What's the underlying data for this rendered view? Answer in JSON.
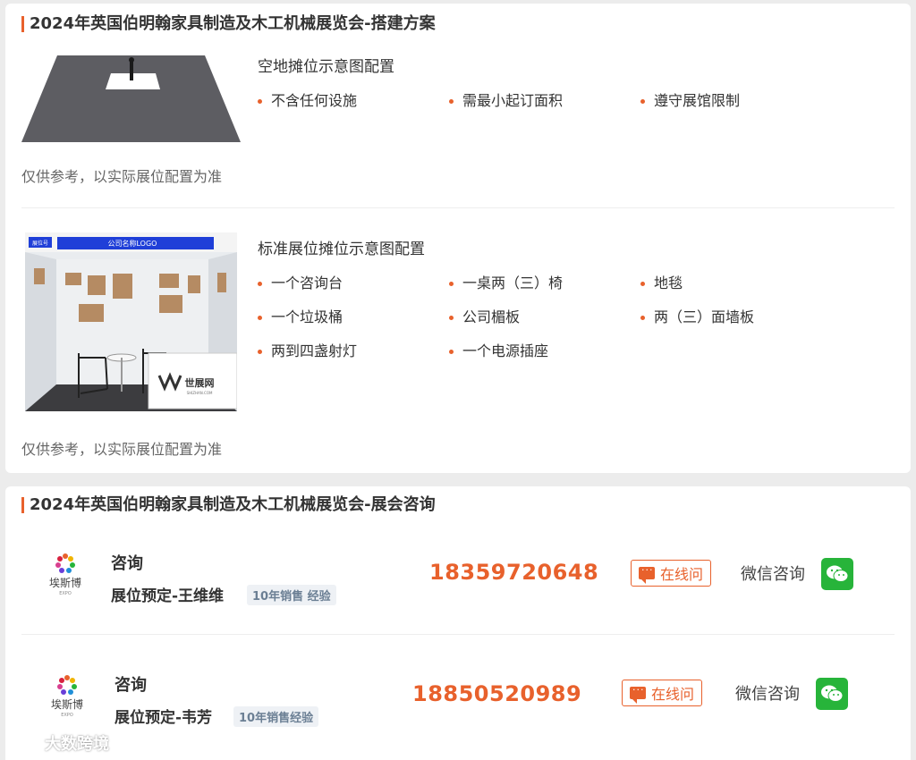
{
  "booth": {
    "title": "2024年英国伯明翰家具制造及木工机械展览会-搭建方案",
    "plans": [
      {
        "title": "空地摊位示意图配置",
        "features": [
          "不含任何设施",
          "需最小起订面积",
          "遵守展馆限制"
        ],
        "note": "仅供参考，以实际展位配置为准"
      },
      {
        "title": "标准展位摊位示意图配置",
        "features": [
          "一个咨询台",
          "一桌两（三）椅",
          "地毯",
          "一个垃圾桶",
          "公司楣板",
          "两（三）面墙板",
          "两到四盏射灯",
          "一个电源插座"
        ],
        "note": "仅供参考，以实际展位配置为准",
        "image_labels": {
          "booth_no": "展位号",
          "fascia": "公司名称LOGO",
          "desk_brand": "世展网",
          "desk_sub": "SHIZHAN.COM"
        }
      }
    ]
  },
  "consult": {
    "title": "2024年英国伯明翰家具制造及木工机械展览会-展会咨询",
    "contacts": [
      {
        "logo_text": "埃斯博",
        "logo_sub": "EXPO",
        "label": "咨询",
        "name": "展位预定-王维维",
        "tag": "10年销售 经验",
        "phone": "18359720648",
        "online": "在线问",
        "wechat": "微信咨询"
      },
      {
        "logo_text": "埃斯博",
        "logo_sub": "EXPO",
        "label": "咨询",
        "name": "展位预定-韦芳",
        "tag": "10年销售经验",
        "phone": "18850520989",
        "online": "在线问",
        "wechat": "微信咨询"
      }
    ]
  },
  "watermark": "大数跨境",
  "colors": {
    "accent": "#e8612c",
    "wechat": "#27b43a",
    "background": "#ececec"
  }
}
